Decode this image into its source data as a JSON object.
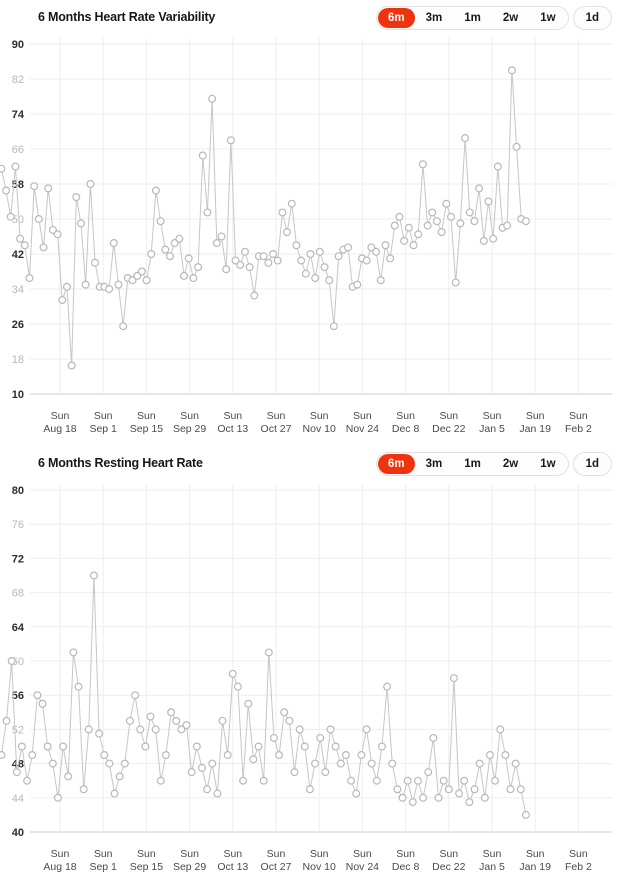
{
  "theme": {
    "accent": "#f0330f",
    "marker_stroke": "#b8b8bc",
    "line_stroke": "#c6c6ca",
    "grid": "#eeeef0",
    "axis": "#d8d8dc",
    "label_dark": "#2b2b30",
    "label_light": "#b6b6bc"
  },
  "segmented": {
    "options": [
      "6m",
      "3m",
      "1m",
      "2w",
      "1w",
      "1d"
    ],
    "selected": "6m",
    "group_breaks": 5
  },
  "panels": [
    {
      "title": "6 Months Heart Rate Variability"
    },
    {
      "title": "6 Months Resting Heart Rate"
    }
  ],
  "x_axis": {
    "labels": [
      {
        "line1": "Sun",
        "line2": "Aug 18"
      },
      {
        "line1": "Sun",
        "line2": "Sep 1"
      },
      {
        "line1": "Sun",
        "line2": "Sep 15"
      },
      {
        "line1": "Sun",
        "line2": "Sep 29"
      },
      {
        "line1": "Sun",
        "line2": "Oct 13"
      },
      {
        "line1": "Sun",
        "line2": "Oct 27"
      },
      {
        "line1": "Sun",
        "line2": "Nov 10"
      },
      {
        "line1": "Sun",
        "line2": "Nov 24"
      },
      {
        "line1": "Sun",
        "line2": "Dec 8"
      },
      {
        "line1": "Sun",
        "line2": "Dec 22"
      },
      {
        "line1": "Sun",
        "line2": "Jan 5"
      },
      {
        "line1": "Sun",
        "line2": "Jan 19"
      },
      {
        "line1": "Sun",
        "line2": "Feb 2"
      }
    ]
  },
  "chart_data": [
    {
      "type": "line",
      "title": "6 Months Heart Rate Variability",
      "xlabel": "",
      "ylabel": "",
      "ylim": [
        10,
        90
      ],
      "ytick_step": 8,
      "yticks": [
        90,
        82,
        74,
        66,
        58,
        50,
        42,
        34,
        26,
        18,
        10
      ],
      "emphasized_yticks": [
        90,
        74,
        58,
        42,
        26,
        10
      ],
      "grid": true,
      "legend": "none",
      "x_categories": [
        "Sun Aug 18",
        "Sun Sep 1",
        "Sun Sep 15",
        "Sun Sep 29",
        "Sun Oct 13",
        "Sun Oct 27",
        "Sun Nov 10",
        "Sun Nov 24",
        "Sun Dec 8",
        "Sun Dec 22",
        "Sun Jan 5",
        "Sun Jan 19",
        "Sun Feb 2"
      ],
      "x_start_index": 19,
      "n_points": 171,
      "values": [
        61.5,
        56.5,
        50.5,
        62.0,
        45.5,
        44.0,
        36.5,
        57.5,
        50.0,
        43.5,
        57.0,
        47.5,
        46.5,
        31.5,
        34.5,
        16.5,
        55.0,
        49.0,
        35.0,
        58.0,
        40.0,
        34.5,
        34.5,
        34.0,
        44.5,
        35.0,
        25.5,
        36.5,
        36.0,
        37.0,
        38.0,
        36.0,
        42.0,
        56.5,
        49.5,
        43.0,
        41.5,
        44.5,
        45.5,
        37.0,
        41.0,
        36.5,
        39.0,
        64.5,
        51.5,
        77.5,
        44.5,
        46.0,
        38.5,
        68.0,
        40.5,
        39.5,
        42.5,
        39.0,
        32.5,
        41.5,
        41.5,
        40.0,
        42.0,
        40.5,
        51.5,
        47.0,
        53.5,
        44.0,
        40.5,
        37.5,
        42.0,
        36.5,
        42.5,
        39.0,
        36.0,
        25.5,
        41.5,
        43.0,
        43.5,
        34.5,
        35.0,
        41.0,
        40.5,
        43.5,
        42.5,
        36.0,
        44.0,
        41.0,
        48.5,
        50.5,
        45.0,
        48.0,
        44.0,
        46.5,
        62.5,
        48.5,
        51.5,
        49.5,
        47.0,
        53.5,
        50.5,
        35.5,
        49.0,
        68.5,
        51.5,
        49.5,
        57.0,
        45.0,
        54.0,
        45.5,
        62.0,
        48.0,
        48.5,
        84.0,
        66.5,
        50.0,
        49.5
      ],
      "min": 16.5,
      "max": 84.0
    },
    {
      "type": "line",
      "title": "6 Months Resting Heart Rate",
      "xlabel": "",
      "ylabel": "",
      "ylim": [
        40,
        80
      ],
      "ytick_step": 4,
      "yticks": [
        80,
        76,
        72,
        68,
        64,
        60,
        56,
        52,
        48,
        44,
        40
      ],
      "emphasized_yticks": [
        80,
        72,
        64,
        56,
        48,
        40
      ],
      "grid": true,
      "legend": "none",
      "x_categories": [
        "Sun Aug 18",
        "Sun Sep 1",
        "Sun Sep 15",
        "Sun Sep 29",
        "Sun Oct 13",
        "Sun Oct 27",
        "Sun Nov 10",
        "Sun Nov 24",
        "Sun Dec 8",
        "Sun Dec 22",
        "Sun Jan 5",
        "Sun Jan 19",
        "Sun Feb 2"
      ],
      "x_start_index": 19,
      "n_points": 171,
      "values": [
        49.0,
        53.0,
        60.0,
        47.0,
        50.0,
        46.0,
        49.0,
        56.0,
        55.0,
        50.0,
        48.0,
        44.0,
        50.0,
        46.5,
        61.0,
        57.0,
        45.0,
        52.0,
        70.0,
        51.5,
        49.0,
        48.0,
        44.5,
        46.5,
        48.0,
        53.0,
        56.0,
        52.0,
        50.0,
        53.5,
        52.0,
        46.0,
        49.0,
        54.0,
        53.0,
        52.0,
        52.5,
        47.0,
        50.0,
        47.5,
        45.0,
        48.0,
        44.5,
        53.0,
        49.0,
        58.5,
        57.0,
        46.0,
        55.0,
        48.5,
        50.0,
        46.0,
        61.0,
        51.0,
        49.0,
        54.0,
        53.0,
        47.0,
        52.0,
        50.0,
        45.0,
        48.0,
        51.0,
        47.0,
        52.0,
        50.0,
        48.0,
        49.0,
        46.0,
        44.5,
        49.0,
        52.0,
        48.0,
        46.0,
        50.0,
        57.0,
        48.0,
        45.0,
        44.0,
        46.0,
        43.5,
        46.0,
        44.0,
        47.0,
        51.0,
        44.0,
        46.0,
        45.0,
        58.0,
        44.5,
        46.0,
        43.5,
        45.0,
        48.0,
        44.0,
        49.0,
        46.0,
        52.0,
        49.0,
        45.0,
        48.0,
        45.0,
        42.0
      ],
      "min": 42.0,
      "max": 70.0
    }
  ]
}
